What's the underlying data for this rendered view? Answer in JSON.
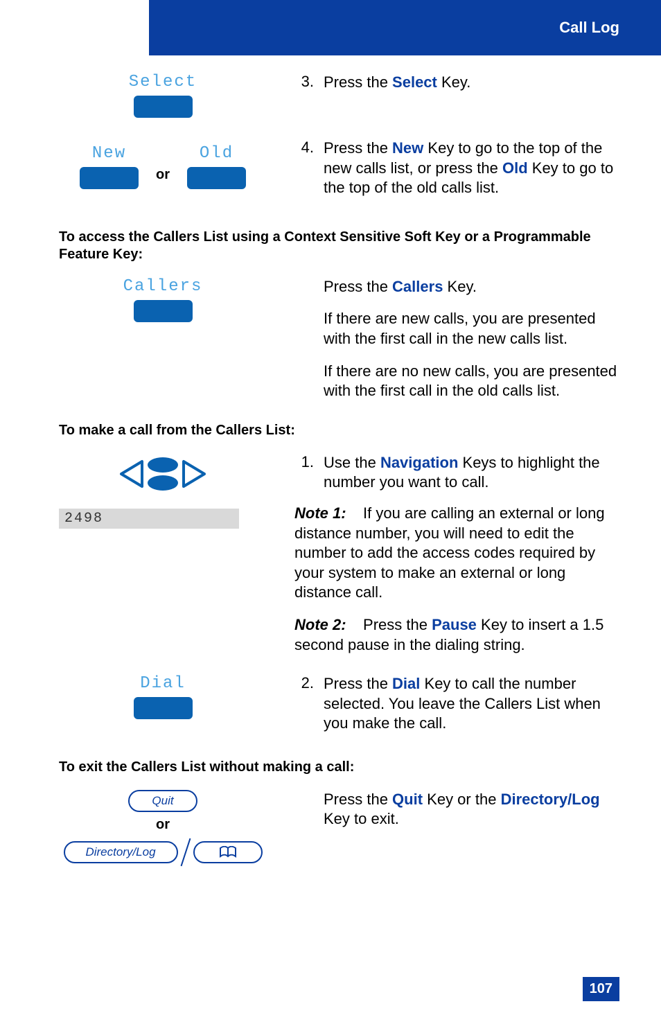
{
  "header": {
    "title": "Call Log"
  },
  "page_number": "107",
  "left": {
    "select_label": "Select",
    "new_label": "New",
    "old_label": "Old",
    "or_text": "or",
    "access_heading": "To access the Callers List using a Context Sensitive Soft Key or a Programmable Feature Key:",
    "callers_label": "Callers",
    "make_call_heading": "To make a call from the Callers List:",
    "display_value": "2498",
    "dial_label": "Dial",
    "exit_heading": "To exit the Callers List without making a call:",
    "quit_label": "Quit",
    "dirlog_label": "Directory/Log",
    "or_text2": "or"
  },
  "right": {
    "step3": {
      "num": "3.",
      "pre": "Press the ",
      "kw": "Select",
      "post": " Key."
    },
    "step4": {
      "num": "4.",
      "pre": "Press the ",
      "kw1": "New",
      "mid": " Key to go to the top of the new calls list, or press the ",
      "kw2": "Old",
      "post": " Key to go to the top of the old calls list."
    },
    "callers_press": {
      "pre": "Press the ",
      "kw": "Callers",
      "post": " Key."
    },
    "callers_p1": "If there are new calls, you are presented with the first call in the new calls list.",
    "callers_p2": "If there are no new calls, you are presented with the first call in the old calls list.",
    "step1": {
      "num": "1.",
      "pre": "Use the ",
      "kw": "Navigation",
      "post": " Keys to highlight the number you want to call."
    },
    "note1": {
      "label": "Note 1:",
      "body": "If you are calling an external or long distance number, you will need to edit the number to add the access codes required by your system to make an external or long distance call."
    },
    "note2": {
      "label": "Note 2:",
      "pre": "Press the ",
      "kw": "Pause",
      "post": " Key to insert a 1.5 second pause in the dialing string."
    },
    "step2": {
      "num": "2.",
      "pre": "Press the ",
      "kw": "Dial",
      "post": " Key to call the number selected. You leave the Callers List when you make the call."
    },
    "exit_press": {
      "pre": "Press  the ",
      "kw1": "Quit",
      "mid": " Key or the ",
      "kw2": "Directory/Log",
      "post": " Key to exit."
    }
  }
}
